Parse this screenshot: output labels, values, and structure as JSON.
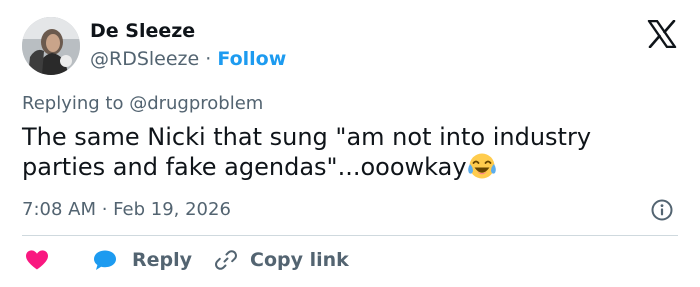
{
  "author": {
    "name": "De Sleeze",
    "handle": "@RDSleeze",
    "separator": "·",
    "follow_label": "Follow"
  },
  "brand": {
    "logo_icon": "x-logo-icon",
    "color": "#0f1419"
  },
  "tweet": {
    "replying_to": "Replying to @drugproblem",
    "text_line1": "The same Nicki that sung \"am not into industry",
    "text_line2": "parties and fake agendas\"...ooowkay",
    "emoji": "face-with-tears-of-joy",
    "timestamp": "7:08 AM · Feb 19, 2026"
  },
  "actions": {
    "like_icon": "heart-icon",
    "like_color": "#f91880",
    "reply_icon": "speech-bubble-icon",
    "reply_color": "#1d9bf0",
    "reply_label": "Reply",
    "copy_icon": "link-icon",
    "copy_label": "Copy link"
  },
  "colors": {
    "accent": "#1d9bf0",
    "secondary_text": "#536471",
    "primary_text": "#0f1419"
  }
}
